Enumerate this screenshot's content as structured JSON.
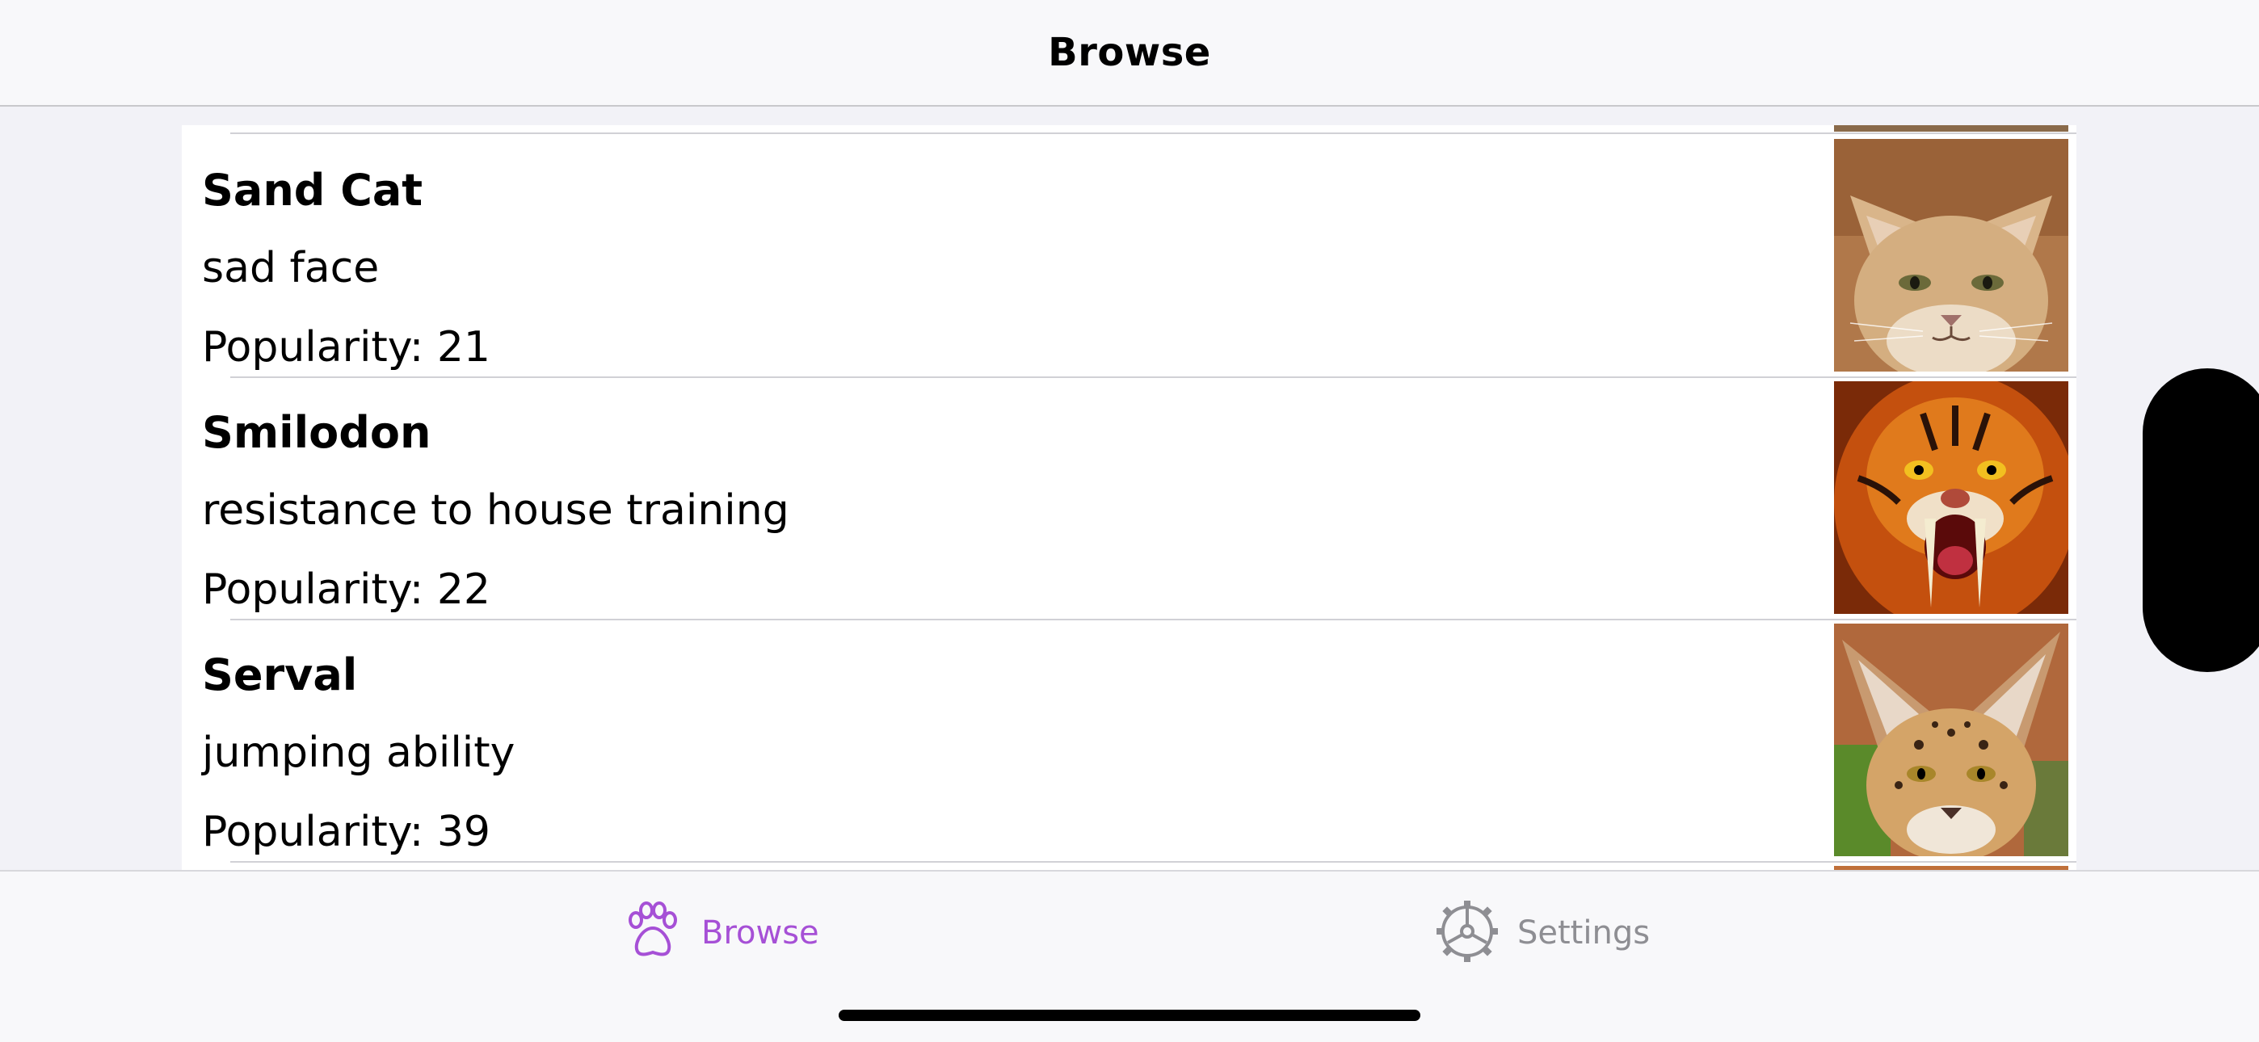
{
  "navbar": {
    "title": "Browse"
  },
  "cats": [
    {
      "name": "Sand Cat",
      "trait": "sad face",
      "popularity": "Popularity: 21",
      "image": "sand-cat-photo"
    },
    {
      "name": "Smilodon",
      "trait": "resistance to house training",
      "popularity": "Popularity: 22",
      "image": "smilodon-photo"
    },
    {
      "name": "Serval",
      "trait": "jumping ability",
      "popularity": "Popularity: 39",
      "image": "serval-photo"
    }
  ],
  "tabs": [
    {
      "label": "Browse",
      "icon": "paw-icon",
      "selected": true,
      "color": "#a650d6"
    },
    {
      "label": "Settings",
      "icon": "gear-icon",
      "selected": false,
      "color": "#8e8e93"
    }
  ],
  "colors": {
    "accent": "#a650d6",
    "inactive": "#8e8e93",
    "background": "#f2f2f7"
  }
}
